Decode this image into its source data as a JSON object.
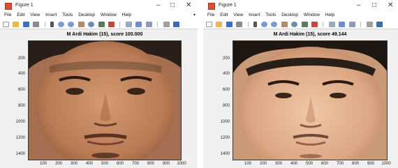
{
  "windows": [
    {
      "title": "Figure 1",
      "menu": [
        "File",
        "Edit",
        "View",
        "Insert",
        "Tools",
        "Desktop",
        "Window",
        "Help"
      ],
      "plot_title": "M Ardi Hakim (15), score 100.000",
      "y_ticks": [
        "200",
        "400",
        "600",
        "800",
        "1000",
        "1200",
        "1400"
      ],
      "x_ticks": [
        "100",
        "200",
        "300",
        "400",
        "500",
        "600",
        "700",
        "800",
        "900",
        "1000"
      ]
    },
    {
      "title": "Figure 1",
      "menu": [
        "File",
        "Edit",
        "View",
        "Insert",
        "Tools",
        "Desktop",
        "Window",
        "Help"
      ],
      "plot_title": "M Ardi Hakim (15), score 49.144",
      "y_ticks": [
        "200",
        "400",
        "600",
        "800",
        "1000",
        "1200",
        "1400"
      ],
      "x_ticks": [
        "100",
        "200",
        "300",
        "400",
        "500",
        "600",
        "700",
        "800",
        "900",
        "1000"
      ]
    }
  ],
  "icons": [
    "new-file-icon",
    "open-folder-icon",
    "save-icon",
    "print-icon",
    "pointer-icon",
    "zoom-in-icon",
    "zoom-out-icon",
    "pan-icon",
    "rotate-icon",
    "data-cursor-icon",
    "brush-icon",
    "link-plot-icon",
    "colorbar-icon",
    "legend-icon",
    "grid-icon",
    "dock-icon"
  ],
  "window_controls": {
    "minimize": "–",
    "maximize": "□",
    "close": "✕"
  },
  "colors": {
    "figure_bg": "#f0f0f0",
    "skin1": "#c98b64",
    "skin2": "#e1b08c"
  }
}
